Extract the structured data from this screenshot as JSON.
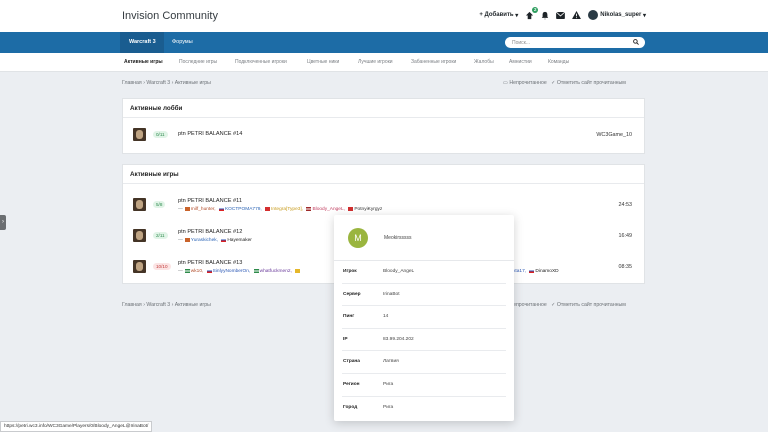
{
  "header": {
    "title": "Invision Community",
    "add_label": "Добавить",
    "notif_count": "2",
    "username": "Nikolas_super"
  },
  "nav": {
    "items": [
      {
        "label": "Warcraft 3"
      },
      {
        "label": "Форумы"
      }
    ],
    "search_placeholder": "Поиск..."
  },
  "subnav": [
    "Активные игры",
    "Последние игры",
    "Подключенные игроки",
    "Цветные ники",
    "Лучшие игроки",
    "Забаненные игроки",
    "Жалобы",
    "Амнистии",
    "Команды"
  ],
  "breadcrumb": {
    "home": "Главная",
    "section": "Warcraft 3",
    "current": "Активные игры",
    "unread": "Непрочитанное",
    "mark_read": "Отметить сайт прочитанным"
  },
  "lobbies": {
    "title": "Активные лобби",
    "rows": [
      {
        "count": "0/11",
        "name": "ptn PETRI BALANCE #14",
        "right": "WC3Game_10"
      }
    ]
  },
  "games": {
    "title": "Активные игры",
    "rows": [
      {
        "count": "5/8",
        "name": "ptn PETRI BALANCE #11",
        "players": [
          "milf_hunter,",
          "KOCTPOMA779,",
          "Integra[Type3],",
          "Bloody_AngeL,",
          "PotnyiKyrgyz"
        ],
        "time": "24:53"
      },
      {
        "count": "2/11",
        "name": "ptn PETRI BALANCE #12",
        "players": [
          "Yuraskichek,",
          "Hayemaker"
        ],
        "time": "16:49"
      },
      {
        "count": "10/10",
        "name": "ptn PETRI BALANCE #13",
        "players": [
          "wk10,",
          "SinlyyNomberOn,",
          "whatfuckmen2,",
          "kta17,",
          "DinamoXD"
        ],
        "time": "08:35"
      }
    ]
  },
  "popup": {
    "avatar_letter": "M",
    "nickname": "Meokirsssss",
    "fields": [
      {
        "label": "Игрок",
        "value": "Bloody_AngeL"
      },
      {
        "label": "Сервер",
        "value": "IrinaBot"
      },
      {
        "label": "Пинг",
        "value": "14"
      },
      {
        "label": "IP",
        "value": "83.99.204.202"
      },
      {
        "label": "Страна",
        "value": "Латвия"
      },
      {
        "label": "Регион",
        "value": "Рига"
      },
      {
        "label": "Город",
        "value": "Рига"
      }
    ]
  },
  "status_url": "https://petri.wc3.info/WC3Game/Players/0/Bloody_AngeL@IrinaBot/"
}
